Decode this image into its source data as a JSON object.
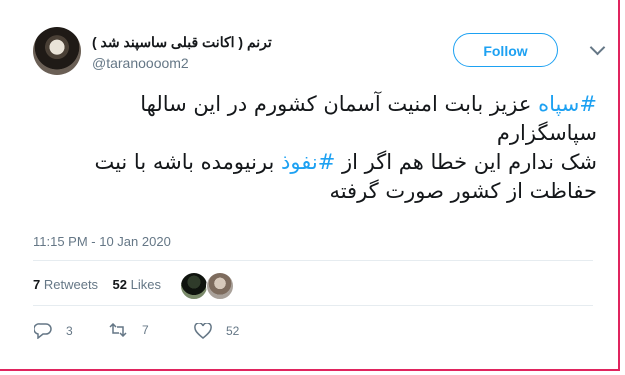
{
  "header": {
    "display_name": "ترنم ( اکانت قبلی ساسپند شد )",
    "handle": "@taranoooom2",
    "follow_label": "Follow"
  },
  "tweet": {
    "lines": [
      [
        {
          "text": "#سپاه",
          "link": true
        },
        {
          "text": " عزیز بابت امنیت آسمان کشورم در این سالها",
          "link": false
        }
      ],
      [
        {
          "text": "سپاسگزارم",
          "link": false
        }
      ],
      [
        {
          "text": "شک ندارم این خطا هم اگر از ",
          "link": false
        },
        {
          "text": "#نفوذ",
          "link": true
        },
        {
          "text": " برنیومده باشه با نیت",
          "link": false
        }
      ],
      [
        {
          "text": "حفاظت از کشور صورت گرفته",
          "link": false
        }
      ]
    ],
    "timestamp": "11:15 PM - 10 Jan 2020"
  },
  "stats": {
    "retweets_count": "7",
    "retweets_label": "Retweets",
    "likes_count": "52",
    "likes_label": "Likes"
  },
  "actions": {
    "reply_count": "3",
    "retweet_count": "7",
    "like_count": "52"
  },
  "colors": {
    "accent": "#1da1f2",
    "border": "#e0245e"
  }
}
